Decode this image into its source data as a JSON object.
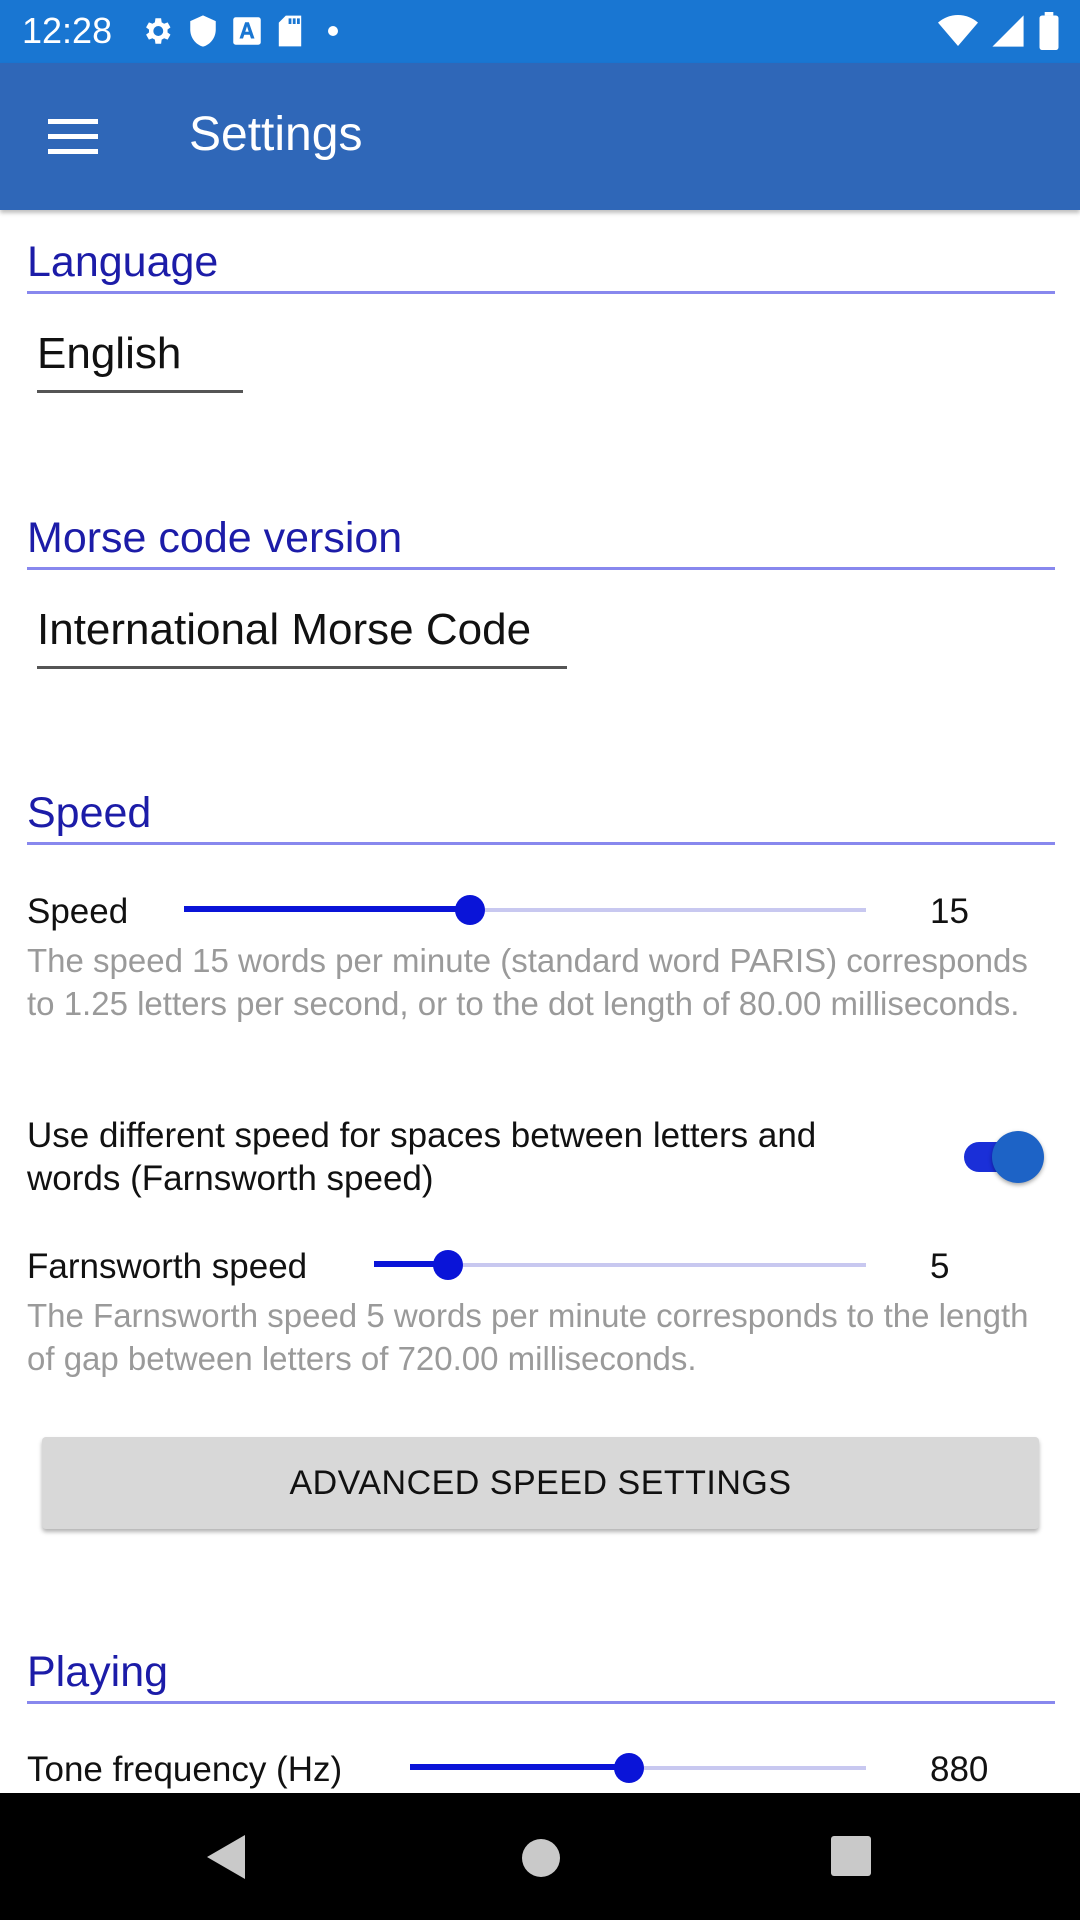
{
  "status_bar": {
    "time": "12:28",
    "left_icons": [
      "gear-icon",
      "shield-icon",
      "font-a-icon",
      "sd-card-icon",
      "dot-icon"
    ],
    "right_icons": [
      "wifi-icon",
      "signal-icon",
      "battery-icon"
    ]
  },
  "app_bar": {
    "title": "Settings",
    "menu_icon": "hamburger-menu-icon"
  },
  "sections": {
    "language": {
      "title": "Language",
      "selected": "English"
    },
    "morse_version": {
      "title": "Morse code version",
      "selected": "International Morse Code"
    },
    "speed": {
      "title": "Speed",
      "speed_label": "Speed",
      "speed_value": "15",
      "speed_slider_fraction": 0.42,
      "speed_description": "The speed 15 words per minute (standard word PARIS) corresponds to 1.25 letters per second, or to the dot length of 80.00 milliseconds.",
      "farnsworth_toggle_label": "Use different speed for spaces between letters and words (Farnsworth speed)",
      "farnsworth_toggle_on": true,
      "farnsworth_label": "Farnsworth speed",
      "farnsworth_value": "5",
      "farnsworth_slider_fraction": 0.15,
      "farnsworth_description": "The Farnsworth speed 5 words per minute corresponds to the length of gap between letters of 720.00 milliseconds.",
      "advanced_button": "ADVANCED SPEED SETTINGS"
    },
    "playing": {
      "title": "Playing",
      "tone_label": "Tone frequency (Hz)",
      "tone_value": "880",
      "tone_slider_fraction": 0.48
    }
  },
  "nav_bar": {
    "icons": [
      "back-icon",
      "home-icon",
      "recent-apps-icon"
    ]
  },
  "colors": {
    "status_bar": "#1976d2",
    "app_bar": "#2f67b8",
    "section_title": "#1c1ca8",
    "accent": "#0a14d8",
    "description_text": "#9a9a9a"
  }
}
